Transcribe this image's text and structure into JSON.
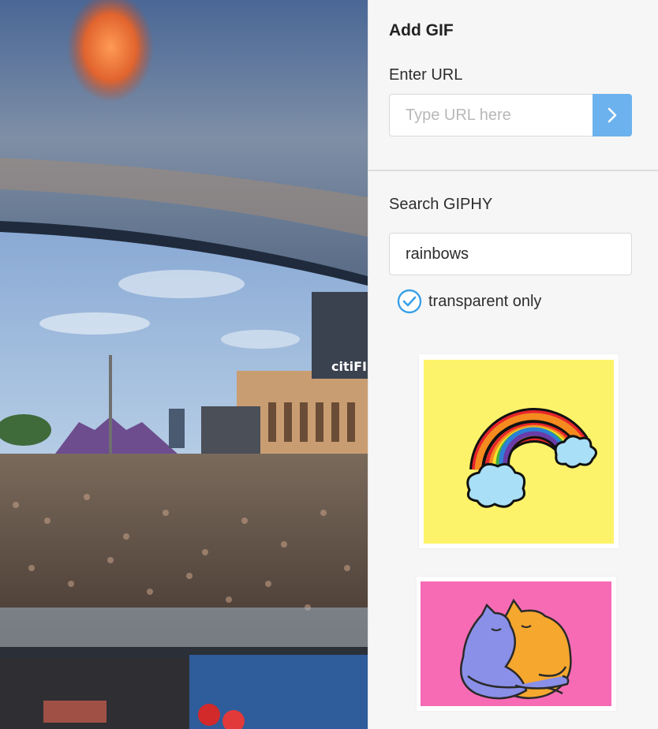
{
  "panel": {
    "title": "Add GIF",
    "enter_url_label": "Enter URL",
    "url_placeholder": "Type URL here",
    "search_label": "Search GIPHY",
    "search_value": "rainbows",
    "transparent_label": "transparent only",
    "transparent_checked": true
  },
  "photo": {
    "stadium_sign": "citiFIE"
  },
  "results": [
    {
      "name": "rainbow-with-clouds",
      "bg": "#fdf36a"
    },
    {
      "name": "hugging-cats",
      "bg": "#f76bb4"
    }
  ],
  "colors": {
    "accent": "#6cb2ee",
    "check": "#3aa0e6"
  },
  "icons": [
    "chevron-right-icon",
    "check-circle-icon"
  ]
}
